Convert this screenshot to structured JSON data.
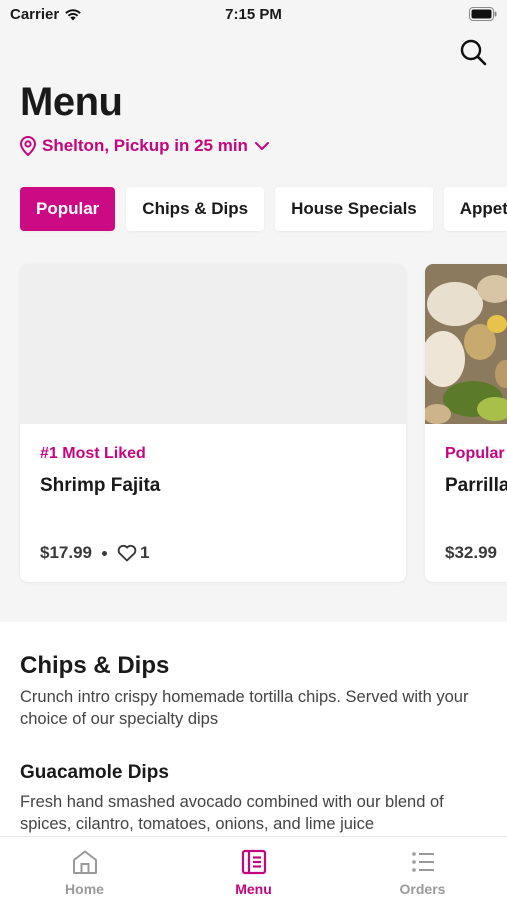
{
  "status_bar": {
    "carrier": "Carrier",
    "time": "7:15 PM"
  },
  "header": {
    "title": "Menu",
    "location": "Shelton, Pickup in 25 min"
  },
  "tabs": [
    {
      "label": "Popular",
      "active": true
    },
    {
      "label": "Chips & Dips",
      "active": false
    },
    {
      "label": "House Specials",
      "active": false
    },
    {
      "label": "Appet",
      "active": false
    }
  ],
  "cards": [
    {
      "badge": "#1 Most Liked",
      "name": "Shrimp Fajita",
      "price": "$17.99",
      "likes": "1"
    },
    {
      "badge": "Popular",
      "name": "Parrilla",
      "price": "$32.99"
    }
  ],
  "section": {
    "title": "Chips & Dips",
    "description": "Crunch intro crispy homemade tortilla chips. Served with your choice of our specialty dips",
    "items": [
      {
        "name": "Guacamole Dips",
        "description": "Fresh hand smashed avocado combined with our blend of spices, cilantro, tomatoes, onions, and lime juice"
      }
    ]
  },
  "tab_bar": [
    {
      "label": "Home",
      "icon": "home-icon",
      "active": false
    },
    {
      "label": "Menu",
      "icon": "menu-book-icon",
      "active": true
    },
    {
      "label": "Orders",
      "icon": "list-icon",
      "active": false
    }
  ],
  "colors": {
    "accent": "#cc0a83",
    "accent_text": "#c4057f",
    "background": "#f5f5f5"
  }
}
